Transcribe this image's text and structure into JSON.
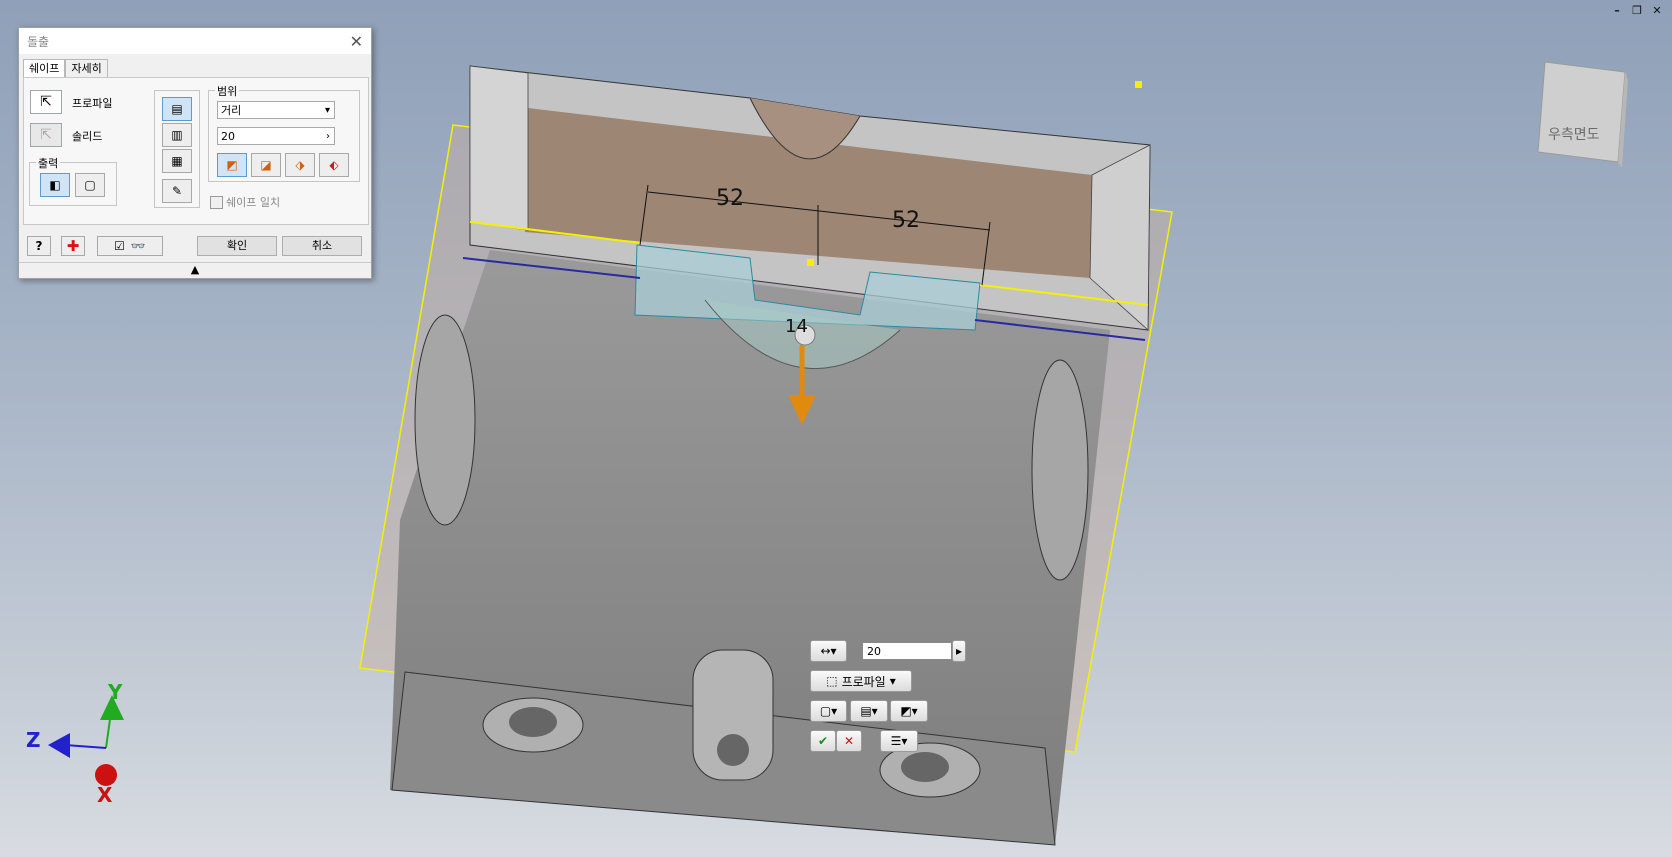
{
  "window_controls": [
    "–",
    "❐",
    "✕"
  ],
  "dialog": {
    "title": "돌출",
    "tabs": [
      "쉐이프",
      "자세히"
    ],
    "profile_label": "프로파일",
    "solid_label": "솔리드",
    "output_group": "출력",
    "range_group": "범위",
    "range_type": "거리",
    "distance_value": "20",
    "match_shape_label": "쉐이프 일치",
    "ok_label": "확인",
    "cancel_label": "취소"
  },
  "viewport": {
    "dimension_left": "52",
    "dimension_right": "52",
    "dimension_center": "14",
    "viewcube_label": "우측면도",
    "axes": {
      "x": "X",
      "y": "Y",
      "z": "Z"
    }
  },
  "mini_toolbar": {
    "distance_value": "20",
    "profile_label": "프로파일"
  },
  "colors": {
    "accent_yellow": "#ffff00",
    "arrow_orange": "#e08a10",
    "selection_blue": "#5a9bd5"
  }
}
